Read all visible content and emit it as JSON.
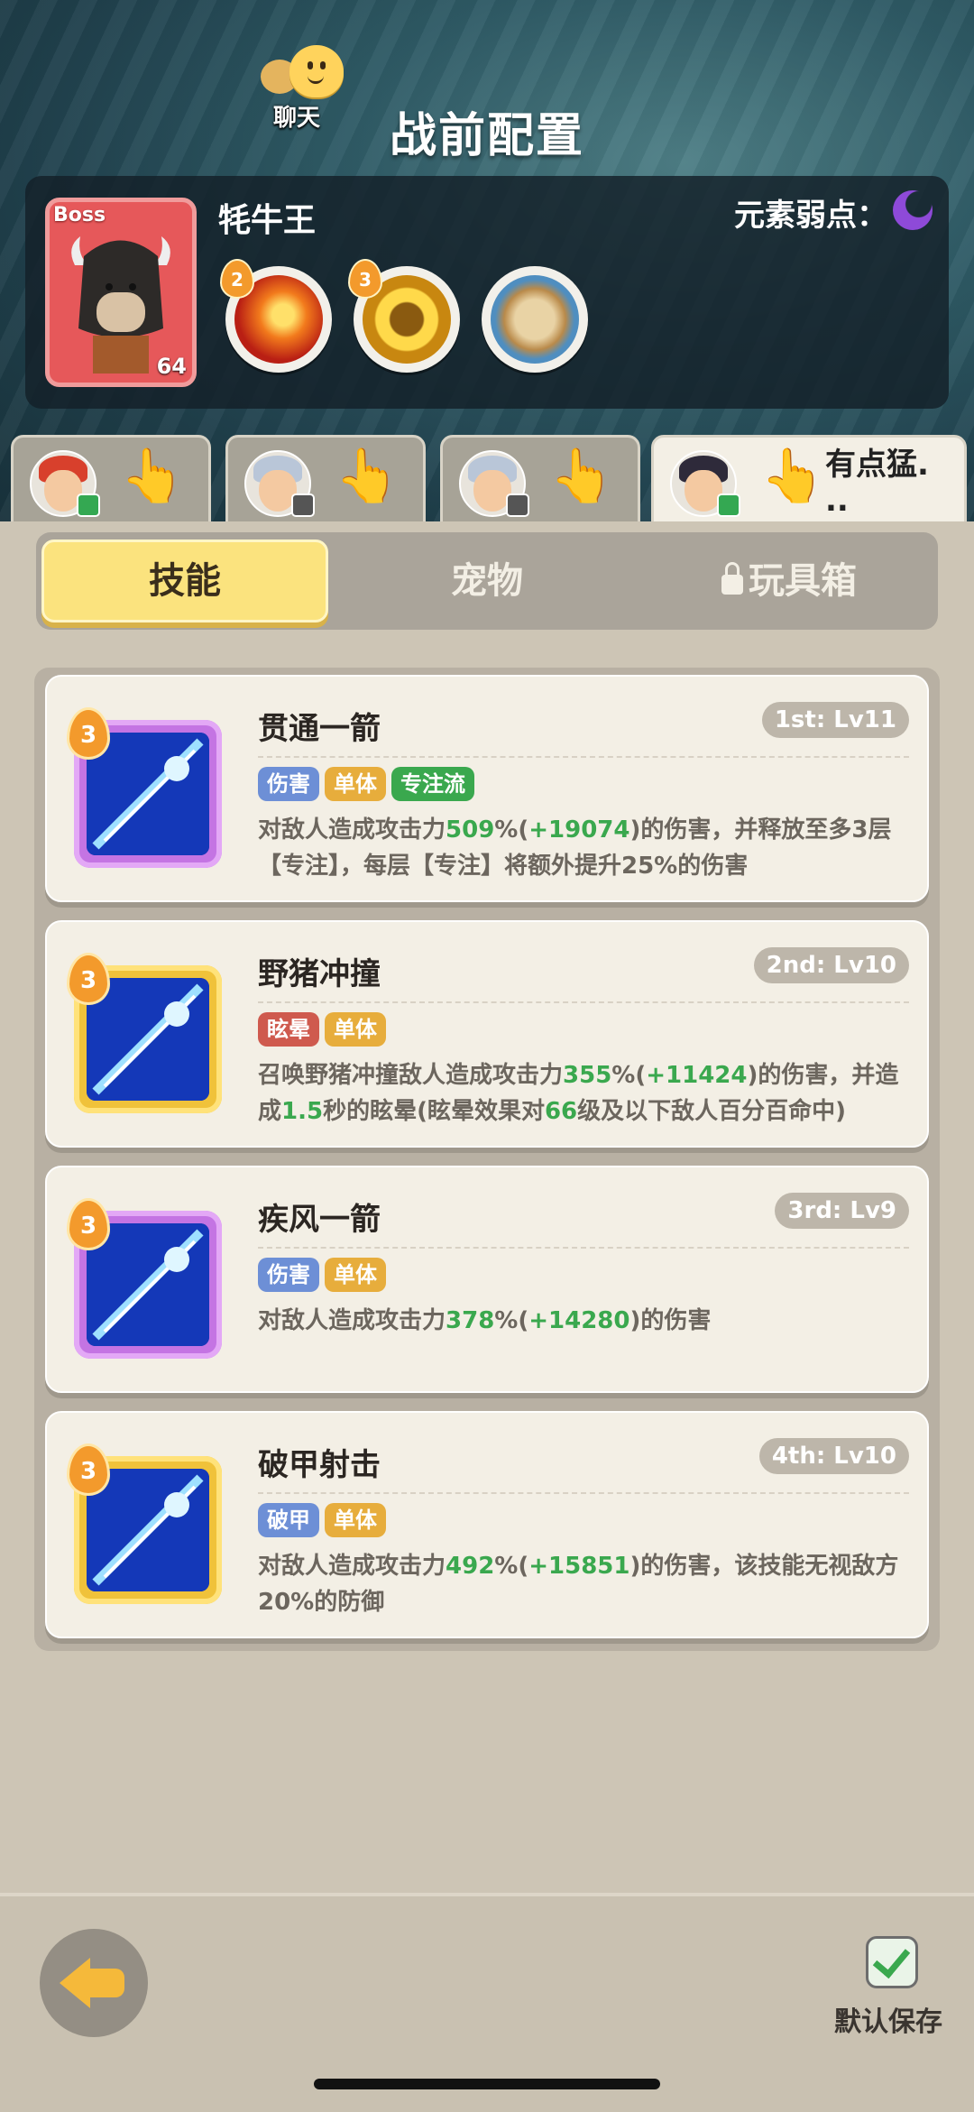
{
  "header": {
    "chat_label": "聊天",
    "title": "战前配置"
  },
  "boss": {
    "tag": "Boss",
    "level": "64",
    "name": "牦牛王",
    "weakness_label": "元素弱点：",
    "weakness_icon": "moon-icon",
    "skills": [
      {
        "icon": "fire-slash-icon",
        "level": "2",
        "color": "#e3422a"
      },
      {
        "icon": "golden-ring-icon",
        "level": "3",
        "color": "#f0b21c"
      },
      {
        "icon": "shield-fist-icon",
        "level": "",
        "color": "#c99a55"
      }
    ]
  },
  "team": [
    {
      "avatar": "red-hair-hero-avatar",
      "badge": "green",
      "name": ""
    },
    {
      "avatar": "silver-hair-hero-avatar",
      "badge": "dark",
      "name": ""
    },
    {
      "avatar": "silver-hair-hero-avatar-2",
      "badge": "dark",
      "name": ""
    },
    {
      "avatar": "black-hair-hero-avatar",
      "badge": "green",
      "name": "有点猛.\n.."
    }
  ],
  "tabs": {
    "skills": "技能",
    "pets": "宠物",
    "toybox": "玩具箱"
  },
  "skills": [
    {
      "name": "贯通一箭",
      "slot": "1st: Lv11",
      "level": "3",
      "frame": "purple",
      "tags": [
        {
          "text": "伤害",
          "color": "blue"
        },
        {
          "text": "单体",
          "color": "gold"
        },
        {
          "text": "专注流",
          "color": "green"
        }
      ],
      "desc_parts": [
        {
          "t": "对敌人造成攻击力",
          "hl": false
        },
        {
          "t": "509",
          "hl": true
        },
        {
          "t": "%(",
          "hl": false
        },
        {
          "t": "+19074",
          "hl": true
        },
        {
          "t": ")的伤害，并释放至多3层【专注】，每层【专注】将额外提升25%的伤害",
          "hl": false
        }
      ]
    },
    {
      "name": "野猪冲撞",
      "slot": "2nd: Lv10",
      "level": "3",
      "frame": "gold",
      "tags": [
        {
          "text": "眩晕",
          "color": "red"
        },
        {
          "text": "单体",
          "color": "gold"
        }
      ],
      "desc_parts": [
        {
          "t": "召唤野猪冲撞敌人造成攻击力",
          "hl": false
        },
        {
          "t": "355",
          "hl": true
        },
        {
          "t": "%(",
          "hl": false
        },
        {
          "t": "+11424",
          "hl": true
        },
        {
          "t": ")的伤害，并造成",
          "hl": false
        },
        {
          "t": "1.5",
          "hl": true
        },
        {
          "t": "秒的眩晕(眩晕效果对",
          "hl": false
        },
        {
          "t": "66",
          "hl": true
        },
        {
          "t": "级及以下敌人百分百命中)",
          "hl": false
        }
      ]
    },
    {
      "name": "疾风一箭",
      "slot": "3rd: Lv9",
      "level": "3",
      "frame": "purple",
      "tags": [
        {
          "text": "伤害",
          "color": "blue"
        },
        {
          "text": "单体",
          "color": "gold"
        }
      ],
      "desc_parts": [
        {
          "t": "对敌人造成攻击力",
          "hl": false
        },
        {
          "t": "378",
          "hl": true
        },
        {
          "t": "%(",
          "hl": false
        },
        {
          "t": "+14280",
          "hl": true
        },
        {
          "t": ")的伤害",
          "hl": false
        }
      ]
    },
    {
      "name": "破甲射击",
      "slot": "4th: Lv10",
      "level": "3",
      "frame": "gold",
      "tags": [
        {
          "text": "破甲",
          "color": "blue"
        },
        {
          "text": "单体",
          "color": "gold"
        }
      ],
      "desc_parts": [
        {
          "t": "对敌人造成攻击力",
          "hl": false
        },
        {
          "t": "492",
          "hl": true
        },
        {
          "t": "%(",
          "hl": false
        },
        {
          "t": "+15851",
          "hl": true
        },
        {
          "t": ")的伤害，该技能无视敌方20%的防御",
          "hl": false
        }
      ]
    }
  ],
  "footer": {
    "save_label": "默认保存"
  }
}
